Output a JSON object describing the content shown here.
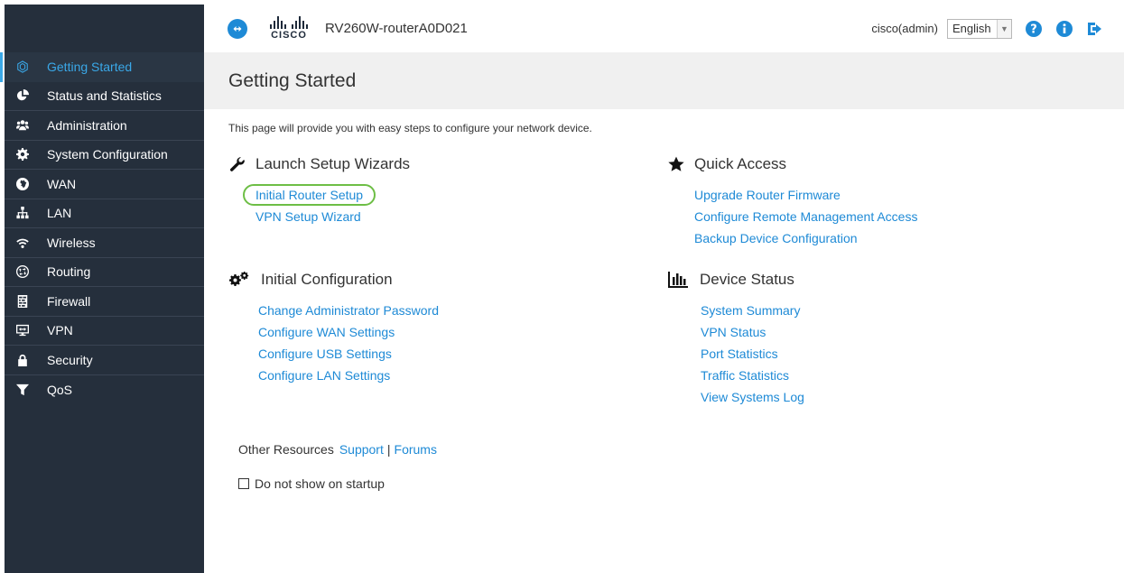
{
  "header": {
    "device_name": "RV260W-routerA0D021",
    "logo_text": "CISCO",
    "user": "cisco(admin)",
    "language": "English"
  },
  "sidebar": {
    "items": [
      {
        "label": "Getting Started",
        "icon": "getting-started-icon",
        "active": true
      },
      {
        "label": "Status and Statistics",
        "icon": "pie-chart-icon"
      },
      {
        "label": "Administration",
        "icon": "users-icon"
      },
      {
        "label": "System Configuration",
        "icon": "gear-icon"
      },
      {
        "label": "WAN",
        "icon": "globe-icon"
      },
      {
        "label": "LAN",
        "icon": "network-icon"
      },
      {
        "label": "Wireless",
        "icon": "wifi-icon"
      },
      {
        "label": "Routing",
        "icon": "routing-icon"
      },
      {
        "label": "Firewall",
        "icon": "firewall-icon"
      },
      {
        "label": "VPN",
        "icon": "vpn-icon"
      },
      {
        "label": "Security",
        "icon": "lock-icon"
      },
      {
        "label": "QoS",
        "icon": "filter-icon"
      }
    ]
  },
  "main": {
    "title": "Getting Started",
    "intro": "This page will provide you with easy steps to configure your network device.",
    "launch": {
      "title": "Launch Setup Wizards",
      "links": [
        "Initial Router Setup",
        "VPN Setup Wizard"
      ]
    },
    "initial": {
      "title": "Initial Configuration",
      "links": [
        "Change Administrator Password",
        "Configure WAN Settings",
        "Configure USB Settings",
        "Configure LAN Settings"
      ]
    },
    "quick": {
      "title": "Quick Access",
      "links": [
        "Upgrade Router Firmware",
        "Configure Remote Management Access",
        "Backup Device Configuration"
      ]
    },
    "status": {
      "title": "Device Status",
      "links": [
        "System Summary",
        "VPN Status",
        "Port Statistics",
        "Traffic Statistics",
        "View Systems Log"
      ]
    },
    "other": {
      "label": "Other Resources",
      "support": "Support",
      "separator": "|",
      "forums": "Forums"
    },
    "startup_label": "Do not show on startup"
  },
  "colors": {
    "accent": "#1e8ad6",
    "sidebar": "#252f3c",
    "active": "#3aa8e8",
    "highlight": "#6dbe45"
  }
}
